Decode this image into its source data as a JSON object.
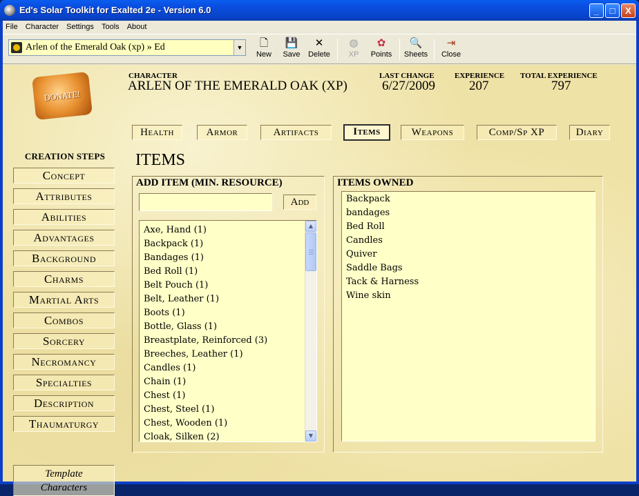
{
  "window": {
    "title": "Ed's Solar Toolkit for Exalted 2e - Version 6.0",
    "controls": {
      "minimize": "_",
      "maximize": "□",
      "close": "X"
    }
  },
  "menu": [
    "File",
    "Character",
    "Settings",
    "Tools",
    "About"
  ],
  "toolbar": {
    "character_selected": "Arlen of the Emerald Oak (xp) » Ed",
    "buttons": {
      "new": "New",
      "save": "Save",
      "delete": "Delete",
      "xp": "XP",
      "points": "Points",
      "sheets": "Sheets",
      "close": "Close"
    },
    "icons": {
      "new": "new-document-icon",
      "save": "floppy-disk-icon",
      "delete": "x-icon",
      "xp": "xp-icon",
      "points": "points-icon",
      "sheets": "sheets-magnifier-icon",
      "close": "exit-door-icon"
    }
  },
  "sidebar": {
    "donate": "DONATE!",
    "creation_title": "CREATION STEPS",
    "steps": [
      "Concept",
      "Attributes",
      "Abilities",
      "Advantages",
      "Background",
      "Charms",
      "Martial Arts",
      "Combos",
      "Sorcery",
      "Necromancy",
      "Specialties",
      "Description",
      "Thaumaturgy"
    ],
    "template_line1": "Template",
    "template_line2": "Characters"
  },
  "header": {
    "character_label": "CHARACTER",
    "character_name": "ARLEN OF THE EMERALD OAK (XP)",
    "last_change_label": "LAST CHANGE",
    "last_change": "6/27/2009",
    "experience_label": "EXPERIENCE",
    "experience": "207",
    "total_experience_label": "TOTAL EXPERIENCE",
    "total_experience": "797"
  },
  "tabs": [
    "Health",
    "Armor",
    "Artifacts",
    "Items",
    "Weapons",
    "Comp/Sp XP",
    "Diary"
  ],
  "active_tab": "Items",
  "section_title": "ITEMS",
  "add_item": {
    "title": "ADD ITEM (MIN. RESOURCE)",
    "input_value": "",
    "add_button": "Add",
    "items": [
      "Axe, Hand (1)",
      "Backpack (1)",
      "Bandages (1)",
      "Bed Roll (1)",
      "Belt Pouch (1)",
      "Belt, Leather (1)",
      "Boots (1)",
      "Bottle, Glass (1)",
      "Breastplate, Reinforced (3)",
      "Breeches, Leather (1)",
      "Candles (1)",
      "Chain (1)",
      "Chest (1)",
      "Chest, Steel (1)",
      "Chest, Wooden (1)",
      "Cloak, Silken (2)"
    ]
  },
  "items_owned": {
    "title": "ITEMS OWNED",
    "items": [
      "Backpack",
      "bandages",
      "Bed Roll",
      "Candles",
      "Quiver",
      "Saddle Bags",
      "Tack & Harness",
      "Wine skin"
    ]
  },
  "colors": {
    "parchment": "#efe2a6",
    "list_background": "#ffffc8",
    "titlebar": "#0a4ee0",
    "chrome": "#ece9d8"
  }
}
